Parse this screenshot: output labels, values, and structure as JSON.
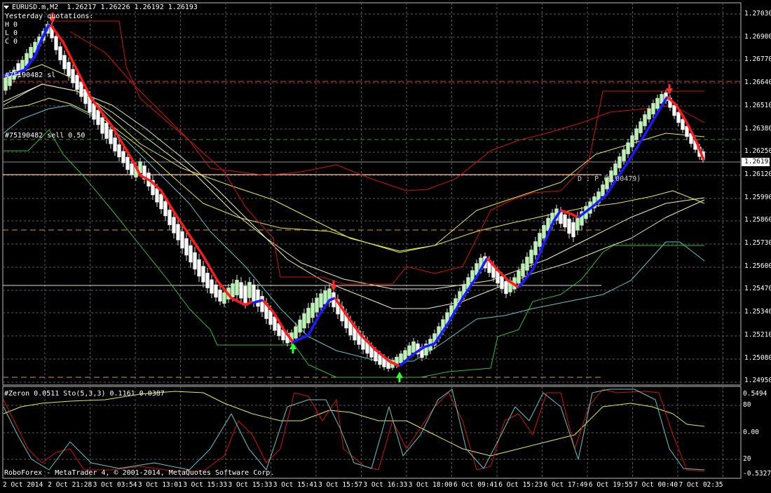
{
  "header": {
    "symbol": "EURUSD.m,M2",
    "quote": "1.26217 1.26226 1.26192 1.26193",
    "yesterday_title": "Yesterday quotations:",
    "yesterday_h": "H 0",
    "yesterday_l": "L 0",
    "yesterday_c": "C 0"
  },
  "order_labels": {
    "sl": "#75190482 sl",
    "sell": "#75190482 sell 0.50",
    "dp": "D : P   (0.00479)"
  },
  "current_price": "1.26193",
  "price_axis": [
    "1.27030",
    "1.26900",
    "1.26770",
    "1.26640",
    "1.26510",
    "1.26380",
    "1.26250",
    "1.26120",
    "1.25990",
    "1.25860",
    "1.25730",
    "1.25600",
    "1.25470",
    "1.25340",
    "1.25210",
    "1.25080",
    "1.24950"
  ],
  "indicator": {
    "label": "#Zeron 0.0511  Sto(5,3,3) 0.1161 0.0387",
    "axis": [
      "0.5494",
      "80",
      "0.00",
      "20",
      "-0.5327"
    ]
  },
  "footer": "RoboForex - MetaTrader 4, © 2001-2014, MetaQuotes Software Corp.",
  "time_axis": [
    "2 Oct 2014",
    "2 Oct 21:28",
    "3 Oct 03:54",
    "3 Oct 13:01",
    "3 Oct 15:33",
    "3 Oct 15:33",
    "3 Oct 15:41",
    "3 Oct 15:57",
    "3 Oct 16:33",
    "3 Oct 18:00",
    "6 Oct 09:41",
    "6 Oct 15:23",
    "6 Oct 17:49",
    "6 Oct 19:55",
    "7 Oct 00:40",
    "7 Oct 02:35"
  ],
  "colors": {
    "bull": "#b7f5b0",
    "bear": "#ffffff",
    "up_line": "#1a1aff",
    "down_line": "#ff1a1a",
    "channel_red": "#d41010",
    "yellow": "#e8e84a",
    "pale": "#f0f0b0",
    "cyan": "#60c8c8",
    "green": "#30c030",
    "grid": "#5a5a5a"
  }
}
